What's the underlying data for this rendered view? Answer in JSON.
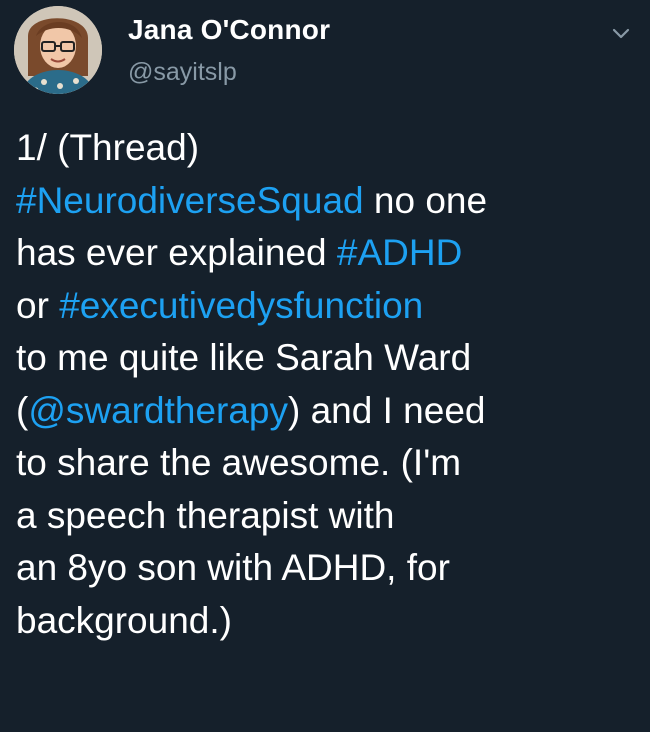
{
  "tweet": {
    "author_name": "Jana O'Connor",
    "author_handle": "@sayitslp",
    "icons": {
      "avatar": "profile-photo",
      "menu": "chevron-down-icon"
    },
    "colors": {
      "background": "#15202b",
      "text": "#ffffff",
      "secondary_text": "#8899a6",
      "link": "#1da1f2"
    },
    "lines": [
      {
        "segments": [
          {
            "text": "1/ (Thread)",
            "type": "text"
          }
        ]
      },
      {
        "segments": [
          {
            "text": "#NeurodiverseSquad",
            "type": "hashtag"
          },
          {
            "text": " no one",
            "type": "text"
          }
        ]
      },
      {
        "segments": [
          {
            "text": "has ever explained ",
            "type": "text"
          },
          {
            "text": "#ADHD",
            "type": "hashtag"
          }
        ]
      },
      {
        "segments": [
          {
            "text": "or ",
            "type": "text"
          },
          {
            "text": "#executivedysfunction",
            "type": "hashtag"
          }
        ]
      },
      {
        "segments": [
          {
            "text": "to me quite like Sarah Ward",
            "type": "text"
          }
        ]
      },
      {
        "segments": [
          {
            "text": "(",
            "type": "text"
          },
          {
            "text": "@swardtherapy",
            "type": "mention"
          },
          {
            "text": ") and I need",
            "type": "text"
          }
        ]
      },
      {
        "segments": [
          {
            "text": "to share the awesome. (I'm",
            "type": "text"
          }
        ]
      },
      {
        "segments": [
          {
            "text": "a speech therapist with",
            "type": "text"
          }
        ]
      },
      {
        "segments": [
          {
            "text": "an 8yo son with ADHD, for",
            "type": "text"
          }
        ]
      },
      {
        "segments": [
          {
            "text": "background.)",
            "type": "text"
          }
        ]
      }
    ]
  }
}
